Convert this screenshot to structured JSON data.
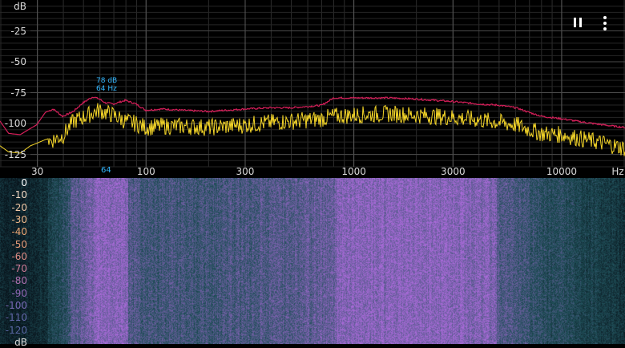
{
  "toolbar": {
    "pause_icon": "pause-icon",
    "more_icon": "more-vert-icon"
  },
  "colors": {
    "live_trace": "#f5d629",
    "peak_hold_trace": "#d61f5a",
    "peak_marker": "#33b7ff",
    "grid": "#444444",
    "spectrogram_hot": "#a86ad8",
    "spectrogram_cold": "#1f4f58"
  },
  "chart_data": [
    {
      "type": "line",
      "x_scale": "log",
      "xlabel_unit": "Hz",
      "ylabel_unit": "dB",
      "xlim": [
        20,
        20000
      ],
      "ylim": [
        -135,
        0
      ],
      "y_ticks": [
        "dB",
        "-25",
        "-50",
        "-75",
        "-100",
        "-125"
      ],
      "x_ticks": [
        "30",
        "100",
        "300",
        "1000",
        "3000",
        "10000",
        "Hz"
      ],
      "x_tick_values": [
        30,
        100,
        300,
        1000,
        3000,
        10000
      ],
      "peak_marker": {
        "db_label": "78 dB",
        "freq_label": "64 Hz",
        "axis_label": "64",
        "freq": 64,
        "db": -78
      },
      "series": [
        {
          "role": "peak-hold",
          "x": [
            20,
            22,
            25,
            28,
            30,
            33,
            36,
            40,
            45,
            50,
            56,
            60,
            64,
            70,
            80,
            90,
            100,
            120,
            150,
            200,
            300,
            400,
            500,
            600,
            700,
            800,
            1000,
            1500,
            2000,
            3000,
            4000,
            5000,
            6000,
            7000,
            8000,
            10000,
            13000,
            16000,
            20000
          ],
          "y": [
            -98,
            -108,
            -109,
            -104,
            -101,
            -91,
            -88,
            -94,
            -90,
            -83,
            -78,
            -80,
            -83,
            -84,
            -81,
            -84,
            -89,
            -88,
            -89,
            -90,
            -88,
            -87,
            -87,
            -86,
            -85,
            -79,
            -79,
            -79,
            -80,
            -82,
            -84,
            -85,
            -87,
            -91,
            -94,
            -96,
            -99,
            -101,
            -103
          ]
        },
        {
          "role": "live",
          "x": [
            20,
            22,
            25,
            28,
            30,
            33,
            36,
            40,
            45,
            50,
            56,
            60,
            64,
            70,
            80,
            90,
            100,
            120,
            150,
            200,
            300,
            400,
            500,
            600,
            700,
            800,
            1000,
            1500,
            2000,
            3000,
            4000,
            5000,
            6000,
            7000,
            8000,
            10000,
            13000,
            16000,
            20000
          ],
          "y": [
            -118,
            -123,
            -124,
            -118,
            -116,
            -113,
            -111,
            -108,
            -96,
            -93,
            -89,
            -87,
            -89,
            -91,
            -96,
            -98,
            -101,
            -100,
            -100,
            -101,
            -99,
            -97,
            -96,
            -95,
            -94,
            -92,
            -91,
            -90,
            -91,
            -93,
            -95,
            -97,
            -99,
            -103,
            -106,
            -107,
            -111,
            -114,
            -118
          ]
        }
      ]
    },
    {
      "type": "heatmap",
      "x_scale": "log",
      "xlim": [
        20,
        20000
      ],
      "y_ticks": [
        "0",
        "-10",
        "-20",
        "-30",
        "-40",
        "-50",
        "-60",
        "-70",
        "-80",
        "-90",
        "-100",
        "-110",
        "-120",
        "dB"
      ],
      "y_tick_colors": [
        "#ffffff",
        "#f2d9c4",
        "#f2c8a6",
        "#f0b889",
        "#eea875",
        "#e89a77",
        "#df8b84",
        "#cf7c98",
        "#b06fb0",
        "#9268b7",
        "#7868b5",
        "#6468ab",
        "#5866a2",
        "#d9d9d9"
      ]
    }
  ]
}
